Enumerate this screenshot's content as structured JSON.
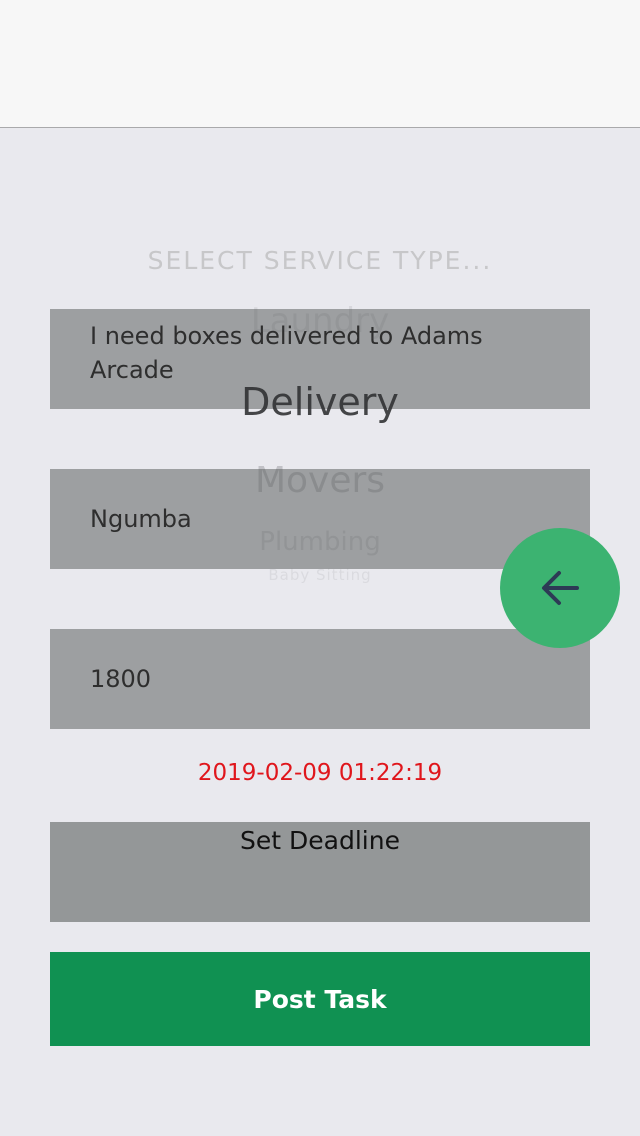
{
  "picker": {
    "title": "SELECT SERVICE TYPE...",
    "options": [
      "Laundry",
      "Delivery",
      "Movers",
      "Plumbing",
      "Baby Sitting"
    ],
    "selected": "Delivery"
  },
  "form": {
    "description": "I need boxes delivered  to Adams Arcade",
    "location": "Ngumba",
    "price": "1800"
  },
  "deadline": {
    "value": "2019-02-09 01:22:19",
    "button_label": "Set Deadline"
  },
  "actions": {
    "post_label": "Post Task",
    "back_icon": "arrow-left-icon"
  },
  "colors": {
    "accent_green": "#109152",
    "fab_green": "#3cb371",
    "date_red": "#e0161c",
    "field_gray": "#9d9fa1"
  }
}
